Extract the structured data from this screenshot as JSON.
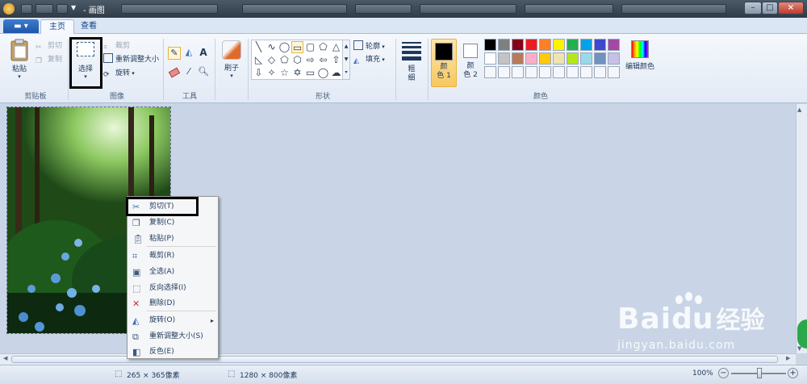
{
  "titlebar": {
    "title": "- 画图",
    "controls": {
      "minimize": "–",
      "maximize": "□",
      "close": "×"
    }
  },
  "tabs": [
    {
      "label": "主页"
    },
    {
      "label": "查看"
    }
  ],
  "app_menu_icon": "menu-icon",
  "clipboard": {
    "group_label": "剪贴板",
    "paste": "粘贴",
    "cut": "剪切",
    "copy": "复制"
  },
  "image": {
    "group_label": "图像",
    "select": "选择",
    "crop": "裁剪",
    "resize": "重新调整大小",
    "rotate": "旋转"
  },
  "tools": {
    "group_label": "工具"
  },
  "brushes": {
    "label": "刷子"
  },
  "shapes": {
    "group_label": "形状",
    "outline": "轮廓",
    "fill": "填充"
  },
  "size": {
    "label": "粗\n细"
  },
  "colors": {
    "group_label": "颜色",
    "color1": "颜\n色 1",
    "color2": "颜\n色 2",
    "edit": "编辑颜色",
    "color1_value": "#000000",
    "color2_value": "#ffffff",
    "palette_row1": [
      "#000000",
      "#7f7f7f",
      "#880015",
      "#ed1c24",
      "#ff7f27",
      "#fff200",
      "#22b14c",
      "#00a2e8",
      "#3f48cc",
      "#a349a4"
    ],
    "palette_row2": [
      "#ffffff",
      "#c3c3c3",
      "#b97a57",
      "#ffaec9",
      "#ffc90e",
      "#efe4b0",
      "#b5e61d",
      "#99d9ea",
      "#7092be",
      "#c8bfe7"
    ]
  },
  "context_menu": {
    "items": [
      {
        "label": "剪切(T)",
        "icon": "scissors-icon"
      },
      {
        "label": "复制(C)",
        "icon": "copy-icon"
      },
      {
        "label": "粘贴(P)",
        "icon": "paste-icon"
      },
      {
        "label": "裁剪(R)",
        "icon": "crop-icon"
      },
      {
        "label": "全选(A)",
        "icon": "select-all-icon"
      },
      {
        "label": "反向选择(I)",
        "icon": "invert-selection-icon"
      },
      {
        "label": "删除(D)",
        "icon": "delete-icon"
      },
      {
        "label": "旋转(O)",
        "icon": "rotate-icon"
      },
      {
        "label": "重新调整大小(S)",
        "icon": "resize-icon"
      },
      {
        "label": "反色(E)",
        "icon": "invert-color-icon"
      }
    ]
  },
  "status": {
    "selection_size": "265 × 365像素",
    "image_size": "1280 × 800像素",
    "zoom": "100%",
    "zoom_out": "−",
    "zoom_in": "+"
  },
  "watermark": {
    "brand": "Bai",
    "brand2": "du",
    "brand_cn": "经验",
    "url": "jingyan.baidu.com"
  }
}
